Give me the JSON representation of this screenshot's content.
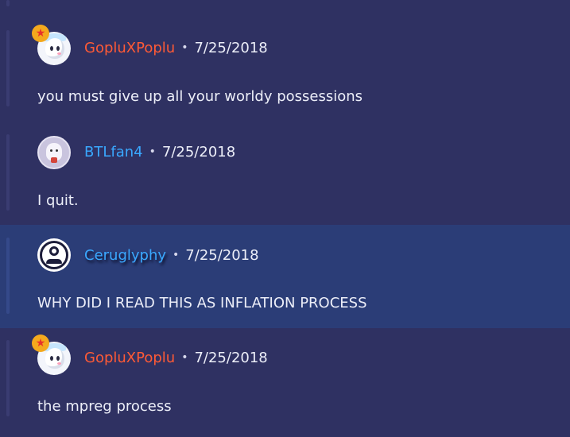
{
  "comments": [
    {
      "username": "GopluXPoplu",
      "date": "7/25/2018",
      "separator": "•",
      "text": "you must give up all your worldy possessions",
      "user_color": "#ff5a36",
      "avatar_icon": "goplu-avatar",
      "badge_icon": "star-badge-icon"
    },
    {
      "username": "BTLfan4",
      "date": "7/25/2018",
      "separator": "•",
      "text": "I quit.",
      "user_color": "#3aa8ff",
      "avatar_icon": "btlfan-avatar"
    },
    {
      "username": "Ceruglyphy",
      "date": "7/25/2018",
      "separator": "•",
      "text": "WHY DID I READ THIS AS INFLATION PROCESS",
      "user_color": "#3aa8ff",
      "avatar_icon": "default-user-icon",
      "highlighted": true
    },
    {
      "username": "GopluXPoplu",
      "date": "7/25/2018",
      "separator": "•",
      "text": "the mpreg process",
      "user_color": "#ff5a36",
      "avatar_icon": "goplu-avatar",
      "badge_icon": "star-badge-icon"
    }
  ],
  "icons": {
    "badge_glyph": "★"
  },
  "colors": {
    "background": "#2f3162",
    "highlight_background": "#2b3d77",
    "text": "#eceef8"
  }
}
